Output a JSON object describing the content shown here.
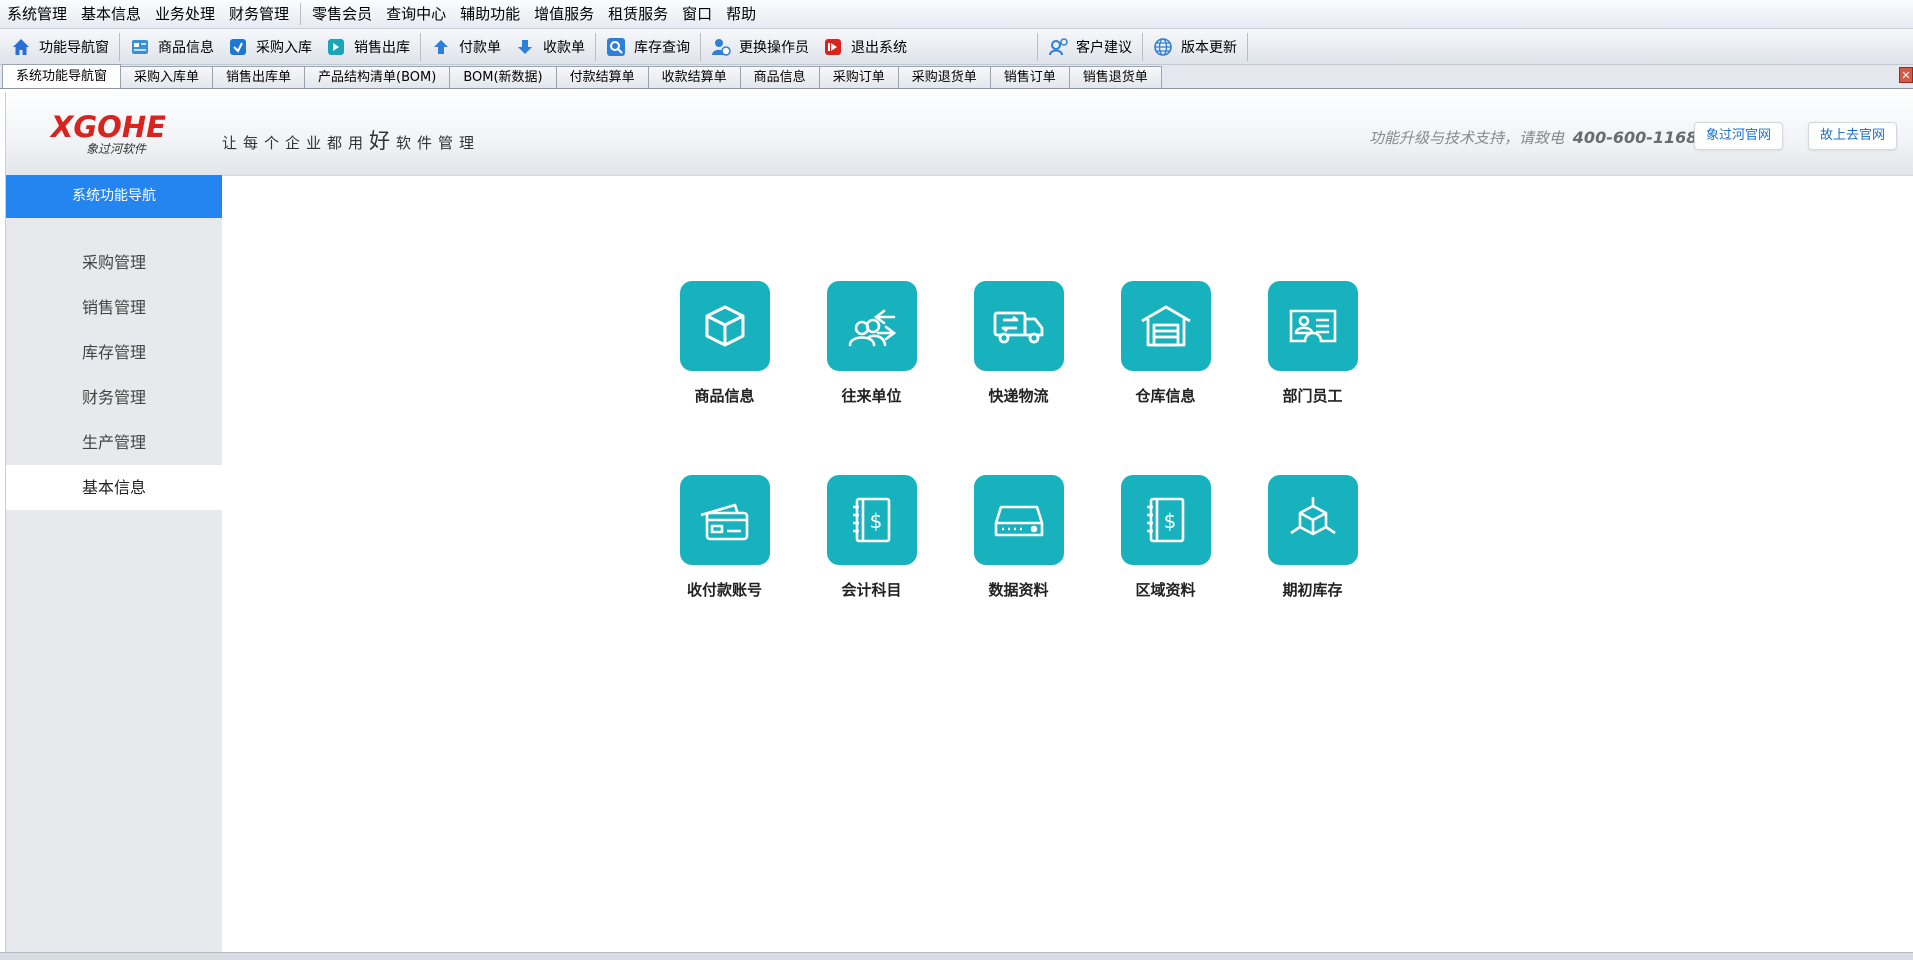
{
  "menubar": {
    "items": [
      "系统管理",
      "基本信息",
      "业务处理",
      "财务管理",
      "零售会员",
      "查询中心",
      "辅助功能",
      "增值服务",
      "租赁服务",
      "窗口",
      "帮助"
    ]
  },
  "toolbar": {
    "nav": "功能导航窗",
    "goods": "商品信息",
    "purchase_in": "采购入库",
    "sales_out": "销售出库",
    "payment": "付款单",
    "receipt": "收款单",
    "stock_query": "库存查询",
    "switch_operator": "更换操作员",
    "exit": "退出系统",
    "feedback": "客户建议",
    "update": "版本更新"
  },
  "tabs": [
    "系统功能导航窗",
    "采购入库单",
    "销售出库单",
    "产品结构清单(BOM)",
    "BOM(新数据)",
    "付款结算单",
    "收款结算单",
    "商品信息",
    "采购订单",
    "采购退货单",
    "销售订单",
    "销售退货单"
  ],
  "header": {
    "logo_main": "XGOHE",
    "logo_sub": "象过河软件",
    "slogan_pre": "让每个企业都用",
    "slogan_big": "好",
    "slogan_post": "软件管理",
    "support_text": "功能升级与技术支持，请致电",
    "support_phone": "400-600-1168",
    "official_site": "象过河官网",
    "old_site": "故上去官网"
  },
  "sidebar": {
    "title": "系统功能导航",
    "items": [
      "采购管理",
      "销售管理",
      "库存管理",
      "财务管理",
      "生产管理",
      "基本信息"
    ],
    "active_index": 5
  },
  "tiles": [
    {
      "label": "商品信息",
      "icon": "box-icon"
    },
    {
      "label": "往来单位",
      "icon": "contacts-icon"
    },
    {
      "label": "快递物流",
      "icon": "truck-icon"
    },
    {
      "label": "仓库信息",
      "icon": "warehouse-icon"
    },
    {
      "label": "部门员工",
      "icon": "id-card-icon"
    },
    {
      "label": "收付款账号",
      "icon": "cards-icon"
    },
    {
      "label": "会计科目",
      "icon": "ledger-icon"
    },
    {
      "label": "数据资料",
      "icon": "drive-icon"
    },
    {
      "label": "区域资料",
      "icon": "region-book-icon"
    },
    {
      "label": "期初库存",
      "icon": "cube-icon"
    }
  ],
  "colors": {
    "accent": "#2485f0",
    "tile": "#17b2bd",
    "logo": "#d8231e"
  }
}
